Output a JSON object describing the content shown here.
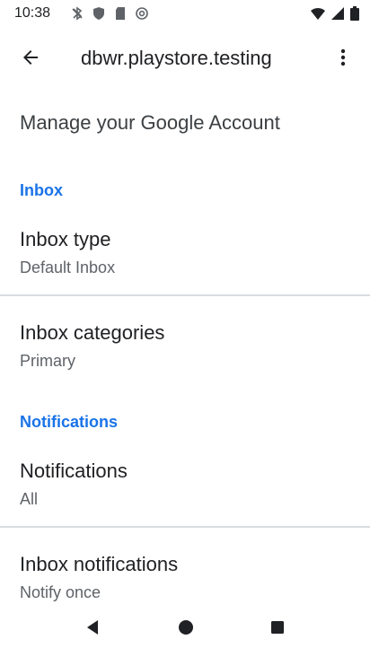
{
  "status_bar": {
    "time": "10:38",
    "left_icons": [
      "bluetooth-off-icon",
      "shield-icon",
      "sd-card-icon",
      "at-sign-icon"
    ],
    "right_icons": [
      "wifi-icon",
      "signal-icon",
      "battery-icon"
    ]
  },
  "app_bar": {
    "title": "dbwr.playstore.testing",
    "back_icon": "arrow-back-icon",
    "overflow_icon": "more-vert-icon"
  },
  "settings": {
    "manage_account": "Manage your Google Account",
    "inbox_header": "Inbox",
    "inbox_type": {
      "title": "Inbox type",
      "summary": "Default Inbox"
    },
    "inbox_categories": {
      "title": "Inbox categories",
      "summary": "Primary"
    },
    "notifications_header": "Notifications",
    "notifications": {
      "title": "Notifications",
      "summary": "All"
    },
    "inbox_notifications": {
      "title": "Inbox notifications",
      "summary": "Notify once"
    }
  },
  "nav_bar": {
    "icons": [
      "nav-back-icon",
      "nav-home-icon",
      "nav-recents-icon"
    ]
  },
  "colors": {
    "accent": "#1a73e8",
    "text_primary": "#202124",
    "text_secondary": "#5f6368",
    "divider": "#dadce0"
  }
}
